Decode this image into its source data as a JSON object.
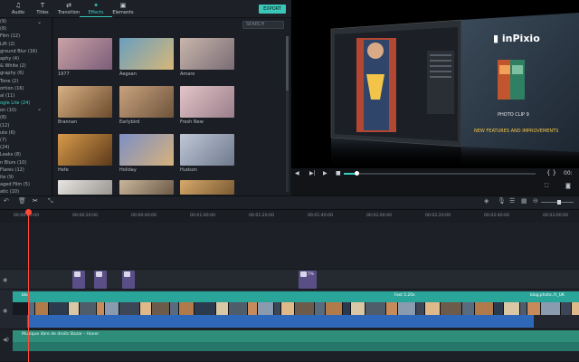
{
  "tabs": [
    {
      "label": "Audio",
      "icon": "music-note-icon",
      "glyph": "♫"
    },
    {
      "label": "Titles",
      "icon": "titles-icon",
      "glyph": "T"
    },
    {
      "label": "Transition",
      "icon": "transition-icon",
      "glyph": "⇄"
    },
    {
      "label": "Effects",
      "icon": "effects-icon",
      "glyph": "✦"
    },
    {
      "label": "Elements",
      "icon": "elements-icon",
      "glyph": "▣"
    }
  ],
  "export_label": "EXPORT",
  "search_placeholder": "SEARCH",
  "categories": [
    "(9)",
    "(8)",
    "Film (12)",
    "Lift (2)",
    "ground Blur (16)",
    "aphy (4)",
    "& White (2)",
    "graphy (6)",
    "Tone (2)",
    "ortion (16)",
    "al (11)",
    "ogle Lite (24)",
    "on (10)",
    "(8)",
    "(12)",
    "ute (6)",
    "(7)",
    "(24)",
    "Leaks (8)",
    "n Blurs (10)",
    "Flares (12)",
    "ite (9)",
    "aged Film (5)",
    "atic (10)",
    "Finder (7)",
    "ute (6)"
  ],
  "selected_category_index": 11,
  "effects": [
    {
      "name": "1977",
      "c1": "#caa3a7",
      "c2": "#7b5d78"
    },
    {
      "name": "Aegean",
      "c1": "#6a9fc0",
      "c2": "#d6b777"
    },
    {
      "name": "Amaro",
      "c1": "#c8b6ab",
      "c2": "#7a6c76"
    },
    {
      "name": "Brannan",
      "c1": "#d8b184",
      "c2": "#6b4a2c"
    },
    {
      "name": "Earlybird",
      "c1": "#c9a27d",
      "c2": "#6e543c"
    },
    {
      "name": "Fresh New",
      "c1": "#e3c5c9",
      "c2": "#9a7e8a"
    },
    {
      "name": "Hefe",
      "c1": "#d89a4a",
      "c2": "#5c3a1b"
    },
    {
      "name": "Holiday",
      "c1": "#7d8fc6",
      "c2": "#d7b27a"
    },
    {
      "name": "Hudson",
      "c1": "#bfc7d6",
      "c2": "#6f7a8d"
    },
    {
      "name": "",
      "c1": "#e7e5e2",
      "c2": "#9a9690"
    },
    {
      "name": "",
      "c1": "#c9b69b",
      "c2": "#6c5a48"
    },
    {
      "name": "",
      "c1": "#d7a96a",
      "c2": "#7b5a33"
    }
  ],
  "preview": {
    "brand": "inPixio",
    "product": "PHOTO CLIP 9",
    "tagline": "NEW FEATURES AND IMPROVEMENTS",
    "timecode": "00:"
  },
  "ruler": [
    "00:00:00:00",
    "00:00:20:00",
    "00:00:40:00",
    "00:01:00:00",
    "00:01:20:00",
    "00:01:40:00",
    "00:02:00:00",
    "00:02:20:00",
    "00:02:40:00",
    "00:03:00:00"
  ],
  "fx_clips": [
    {
      "label": "7%"
    },
    {
      "label": "7%"
    },
    {
      "label": "7%"
    },
    {
      "label": "7%"
    }
  ],
  "video_labels": {
    "start": "blo",
    "mid": "Fast 5.20x",
    "end": "blog.photo..fr_UK"
  },
  "audio_label": "Musique libre de droits Bazar - Hover"
}
